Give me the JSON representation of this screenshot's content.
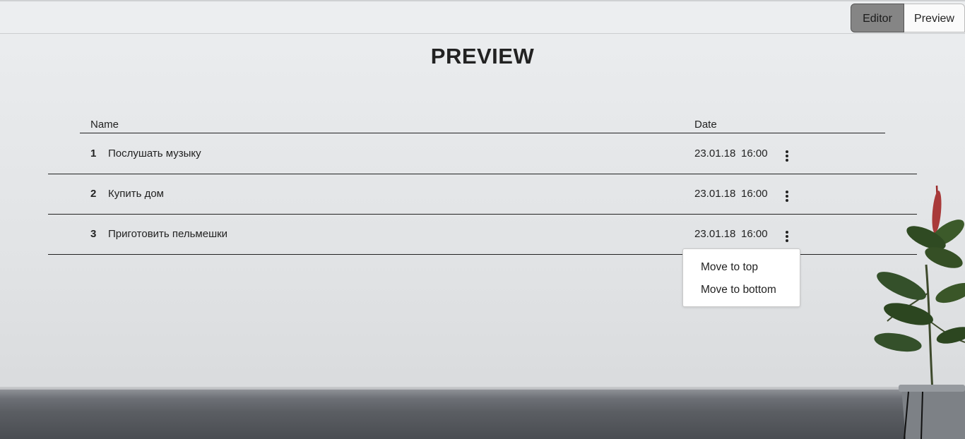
{
  "tabs": [
    {
      "label": "Editor",
      "active": true
    },
    {
      "label": "Preview",
      "active": false
    }
  ],
  "page_title": "PREVIEW",
  "table": {
    "columns": {
      "name": "Name",
      "date": "Date"
    },
    "rows": [
      {
        "num": "1",
        "name": "Послушать музыку",
        "date": "23.01.18",
        "time": "16:00"
      },
      {
        "num": "2",
        "name": "Купить дом",
        "date": "23.01.18",
        "time": "16:00"
      },
      {
        "num": "3",
        "name": "Приготовить пельмешки",
        "date": "23.01.18",
        "time": "16:00"
      }
    ]
  },
  "context_menu": {
    "items": [
      "Move to top",
      "Move to bottom"
    ]
  },
  "colors": {
    "active_tab": "#858585",
    "wall": "#e6e8ea",
    "floor": "#5b5e63"
  }
}
